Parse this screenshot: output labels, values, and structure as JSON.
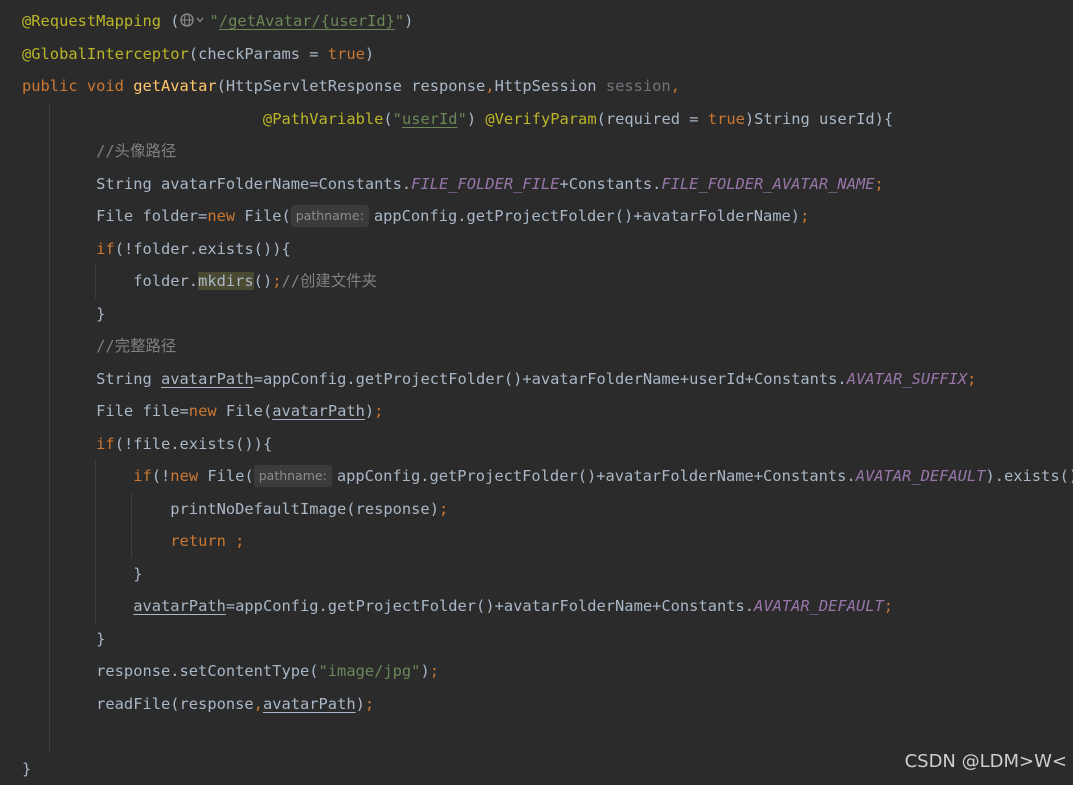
{
  "editor": {
    "lines": [
      [
        {
          "t": "@RequestMapping",
          "c": "ann"
        },
        {
          "t": " ("
        },
        {
          "icon": "globe-chevron-icon"
        },
        {
          "t": "\"",
          "c": "str"
        },
        {
          "t": "/getAvatar/{userId}",
          "c": "str",
          "u": true
        },
        {
          "t": "\"",
          "c": "str"
        },
        {
          "t": ")"
        }
      ],
      [
        {
          "t": "@GlobalInterceptor",
          "c": "ann"
        },
        {
          "t": "(checkParams = "
        },
        {
          "t": "true",
          "c": "kw"
        },
        {
          "t": ")"
        }
      ],
      [
        {
          "t": "public void ",
          "c": "kw"
        },
        {
          "t": "getAvatar",
          "c": "fn"
        },
        {
          "t": "(HttpServletResponse response"
        },
        {
          "t": ",",
          "c": "kw"
        },
        {
          "t": "HttpSession "
        },
        {
          "t": "session",
          "c": "param-dim"
        },
        {
          "t": ",",
          "c": "kw"
        }
      ],
      [
        {
          "t": "                          "
        },
        {
          "t": "@PathVariable",
          "c": "ann"
        },
        {
          "t": "("
        },
        {
          "t": "\"",
          "c": "str"
        },
        {
          "t": "userId",
          "c": "str",
          "u": true
        },
        {
          "t": "\"",
          "c": "str"
        },
        {
          "t": ") "
        },
        {
          "t": "@VerifyParam",
          "c": "ann"
        },
        {
          "t": "(required = "
        },
        {
          "t": "true",
          "c": "kw"
        },
        {
          "t": ")String userId){"
        }
      ],
      [
        {
          "t": "        "
        },
        {
          "t": "//头像路径",
          "c": "cmt"
        }
      ],
      [
        {
          "t": "        String avatarFolderName=Constants."
        },
        {
          "t": "FILE_FOLDER_FILE",
          "c": "konst"
        },
        {
          "t": "+Constants."
        },
        {
          "t": "FILE_FOLDER_AVATAR_NAME",
          "c": "konst"
        },
        {
          "t": ";",
          "c": "kw"
        }
      ],
      [
        {
          "t": "        File folder="
        },
        {
          "t": "new ",
          "c": "kw"
        },
        {
          "t": "File("
        },
        {
          "hint": "pathname:"
        },
        {
          "t": "appConfig.getProjectFolder()+avatarFolderName)"
        },
        {
          "t": ";",
          "c": "kw"
        }
      ],
      [
        {
          "t": "        "
        },
        {
          "t": "if",
          "c": "kw"
        },
        {
          "t": "(!folder.exists()){"
        }
      ],
      [
        {
          "t": "            folder."
        },
        {
          "t": "mkdirs",
          "hl": true
        },
        {
          "t": "()"
        },
        {
          "t": ";",
          "c": "kw"
        },
        {
          "t": "//创建文件夹",
          "c": "cmt"
        }
      ],
      [
        {
          "t": "        }"
        }
      ],
      [
        {
          "t": "        "
        },
        {
          "t": "//完整路径",
          "c": "cmt"
        }
      ],
      [
        {
          "t": "        String "
        },
        {
          "t": "avatarPath",
          "u": true
        },
        {
          "t": "=appConfig.getProjectFolder()+avatarFolderName+userId+Constants."
        },
        {
          "t": "AVATAR_SUFFIX",
          "c": "konst"
        },
        {
          "t": ";",
          "c": "kw"
        }
      ],
      [
        {
          "t": "        File file="
        },
        {
          "t": "new ",
          "c": "kw"
        },
        {
          "t": "File("
        },
        {
          "t": "avatarPath",
          "u": true
        },
        {
          "t": ")"
        },
        {
          "t": ";",
          "c": "kw"
        }
      ],
      [
        {
          "t": "        "
        },
        {
          "t": "if",
          "c": "kw"
        },
        {
          "t": "(!file.exists()){"
        }
      ],
      [
        {
          "t": "            "
        },
        {
          "t": "if",
          "c": "kw"
        },
        {
          "t": "(!"
        },
        {
          "t": "new ",
          "c": "kw"
        },
        {
          "t": "File("
        },
        {
          "hint": "pathname:"
        },
        {
          "t": "appConfig.getProjectFolder()+avatarFolderName+Constants."
        },
        {
          "t": "AVATAR_DEFAULT",
          "c": "konst"
        },
        {
          "t": ").exists()){"
        }
      ],
      [
        {
          "t": "                printNoDefaultImage(response)"
        },
        {
          "t": ";",
          "c": "kw"
        }
      ],
      [
        {
          "t": "                "
        },
        {
          "t": "return ;",
          "c": "kw"
        }
      ],
      [
        {
          "t": "            }"
        }
      ],
      [
        {
          "t": "            "
        },
        {
          "t": "avatarPath",
          "u": true
        },
        {
          "t": "=appConfig.getProjectFolder()+avatarFolderName+Constants."
        },
        {
          "t": "AVATAR_DEFAULT",
          "c": "konst"
        },
        {
          "t": ";",
          "c": "kw"
        }
      ],
      [
        {
          "t": "        }"
        }
      ],
      [
        {
          "t": "        response.setContentType("
        },
        {
          "t": "\"image/jpg\"",
          "c": "str"
        },
        {
          "t": ")"
        },
        {
          "t": ";",
          "c": "kw"
        }
      ],
      [
        {
          "t": "        readFile(response"
        },
        {
          "t": ",",
          "c": "kw"
        },
        {
          "t": "avatarPath",
          "u": true
        },
        {
          "t": ")"
        },
        {
          "t": ";",
          "c": "kw"
        }
      ],
      [],
      [
        {
          "t": "}"
        }
      ]
    ]
  },
  "watermark": "CSDN @LDM>W<",
  "colors": {
    "background": "#2b2b2b",
    "default": "#a9b7c6",
    "keyword": "#cc7832",
    "annotation": "#bbb529",
    "string": "#6a8759",
    "method": "#ffc66d",
    "comment": "#808080",
    "constant": "#9876aa"
  }
}
